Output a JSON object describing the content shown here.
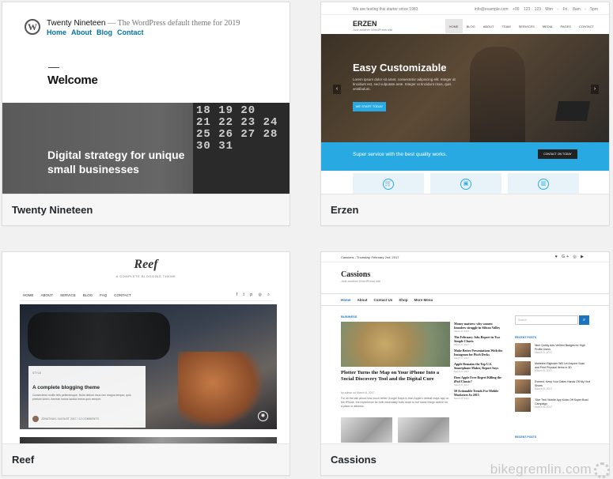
{
  "themes": [
    {
      "name": "Twenty Nineteen",
      "preview": {
        "site_title": "Twenty Nineteen",
        "description": "— The WordPress default theme for 2019",
        "nav": [
          "Home",
          "About",
          "Blog",
          "Contact"
        ],
        "heading": "Welcome",
        "hero_text": "Digital strategy for unique small businesses",
        "calendar": "18 19 20\n21 22 23 24\n25 26 27 28\n30 31"
      }
    },
    {
      "name": "Erzen",
      "preview": {
        "topbar_left": "We are testing this starter since 1983",
        "topbar_right": "info@example.com  +00 123 123  Mon - Fri, 8am - 5pm",
        "brand": "ERZEN",
        "tagline": "Just another WordPress site",
        "menu": [
          "HOME",
          "BLOG",
          "ABOUT",
          "TEAM",
          "SERVICES",
          "MEDIA",
          "PAGES",
          "CONTACT"
        ],
        "hero_title": "Easy Customizable",
        "hero_text": "Lorem ipsum dolor sit amet, consectetur adipiscing elit. Integer at tincidunt est, sed vulputate ante. Integer ut tincidunt risus, quis vestibulum.",
        "hero_button": "WE START TODAY",
        "band_text": "Super service with the best quality works.",
        "band_button": "CONTACT ON TODAY"
      }
    },
    {
      "name": "Reef",
      "preview": {
        "brand": "Reef",
        "tagline": "A COMPLETE BLOGGING THEME",
        "nav": [
          "HOME",
          "ABOUT",
          "SERVICE",
          "BLOG",
          "FAQ",
          "CONTACT"
        ],
        "social": "f t p ◎ ⌕",
        "category": "STYLE",
        "post_title": "A complete blogging theme",
        "excerpt": "Consectetur mollis felis pellentesque. Nulla dictum risus nec magna tempor, quis pretium lorem. Aenean luctus lacinia lectus quis semper.",
        "meta": "JONATHAN / AUGUST 2017 / 12 COMMENTS"
      }
    },
    {
      "name": "Cassions",
      "preview": {
        "date_line": "Cassions - Thursday, February 2nd, 2017",
        "social": "♥ G+ ◎ ▶",
        "brand": "Cassions",
        "tagline": "Just another WordPress site",
        "menu": [
          "Home",
          "About",
          "Contact Us",
          "Shop",
          "More Menu"
        ],
        "section": "BUSINESS",
        "headline": "Plotter Turns the Map on Your iPhone Into a Social Discovery Tool and the Digital Cure",
        "meta": "by admin on March 8, 2017",
        "excerpt": "For all the talk about how much better Google Maps is than Apple's default maps app on the iPhone, the experience for both essentially boils down to the same things search for a place or address.",
        "mid_items": [
          {
            "t": "Money matters: why women founders struggle in Silicon Valley",
            "m": "March 8, 2017"
          },
          {
            "t": "The February Jobs Report in Two Simple Charts",
            "m": "March 8, 2017"
          },
          {
            "t": "Make Better Presentations With the Instagram for Pitch Decks",
            "m": "March 8, 2017"
          },
          {
            "t": "Apple Remains the Top U.S. Smartphone Maker, Report Says",
            "m": "March 8, 2017"
          },
          {
            "t": "Does Apple Ever Regret Killing the iPod Classic?",
            "m": "March 8, 2017"
          },
          {
            "t": "50 Actionable Trends For Mobile Marketers In 2015",
            "m": "March 8, 2017"
          }
        ],
        "search_placeholder": "Search",
        "recent_posts": "RECENT POSTS",
        "recent_posts_2": "RECENT POSTS",
        "side_items": [
          {
            "t": "Nine Quirky Ads Verified Badges for High Profile Users",
            "d": "March 8, 2017"
          },
          {
            "t": "Maheshri Bigfoster Will Let Anyone Scan and Print Physical Items in 3D",
            "d": "March 8, 2017"
          },
          {
            "t": "Everest. Keep Your Dates Hands Off My Hurt Shoes",
            "d": "March 8, 2017"
          },
          {
            "t": "'Star Trek' Mobile App Kicks Off Super Bowl Campaign",
            "d": "March 8, 2017"
          }
        ]
      }
    }
  ],
  "watermark": "bikegremlin.com"
}
